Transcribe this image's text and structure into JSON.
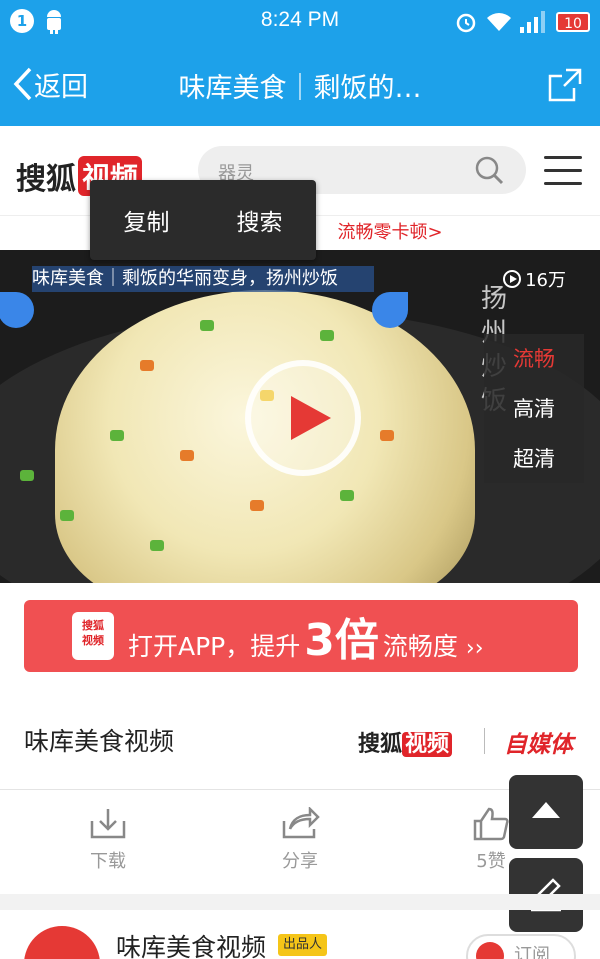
{
  "status_bar": {
    "notification_count": "1",
    "time": "8:24 PM",
    "battery_level": "10",
    "icons": [
      "notification-badge-icon",
      "android-icon",
      "alarm-icon",
      "wifi-icon",
      "signal-icon",
      "battery-icon"
    ]
  },
  "nav": {
    "back_label": "返回",
    "title": "味库美食｜剩饭的…",
    "share_icon": "share-icon"
  },
  "header": {
    "logo_text": "搜狐",
    "logo_red_text": "视频",
    "search_placeholder": "器灵",
    "search_icon": "search-icon",
    "menu_icon": "hamburger-menu-icon"
  },
  "promo_strip_text": "流畅零卡顿>",
  "context_menu": {
    "copy": "复制",
    "search": "搜索"
  },
  "video": {
    "selected_title": "味库美食｜剩饭的华丽变身，扬州炒饭",
    "views": "16万",
    "calligraphy": "扬州炒饭",
    "quality_options": [
      "流畅",
      "高清",
      "超清"
    ],
    "active_quality": "流畅"
  },
  "open_app_banner": {
    "icon_top": "搜狐",
    "icon_bottom": "视频",
    "text_before": "打开APP，提升",
    "big_number": "3倍",
    "text_after": "流畅度",
    "arrow": "››"
  },
  "source": {
    "channel_name": "味库美食视频",
    "sohu_text": "搜狐",
    "sohu_red": "视频",
    "zimeiti": "自媒体"
  },
  "actions": [
    {
      "label": "下载",
      "icon": "download-icon"
    },
    {
      "label": "分享",
      "icon": "share-icon"
    },
    {
      "label": "5赞",
      "icon": "thumbs-up-icon"
    }
  ],
  "floating": {
    "up_icon": "arrow-up-icon",
    "edit_icon": "pencil-icon"
  },
  "author": {
    "name": "味库美食视频",
    "badge": "出品人",
    "subscribe": "订阅"
  },
  "colors": {
    "brand_blue": "#1da1ea",
    "accent_red": "#e53935",
    "banner_red": "#f05052"
  }
}
